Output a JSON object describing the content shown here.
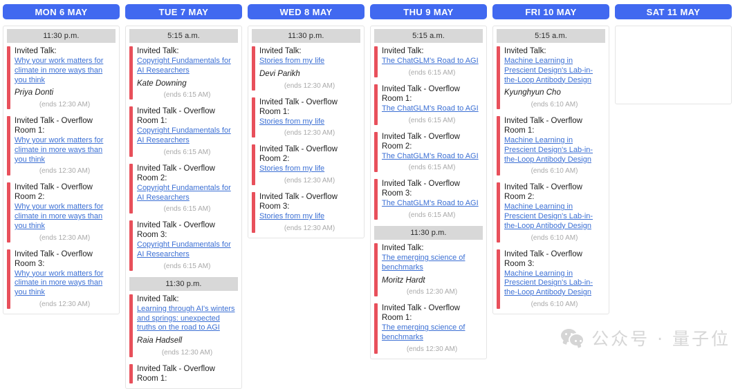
{
  "meta": {
    "accent_header_color": "#4169f0",
    "event_accent_color": "#e8505b",
    "link_color": "#3b6fd4",
    "time_bar_color": "#d8d8d8"
  },
  "watermark": {
    "icon": "wechat-icon",
    "text": "公众号 · 量子位"
  },
  "days": [
    {
      "header": "MON 6 MAY",
      "groups": [
        {
          "time": "11:30 p.m.",
          "events": [
            {
              "type": "Invited Talk:",
              "title": "Why your work matters for climate in more ways than you think",
              "speaker": "Priya Donti",
              "ends": "(ends 12:30 AM)"
            },
            {
              "type": "Invited Talk - Overflow Room 1:",
              "title": "Why your work matters for climate in more ways than you think",
              "speaker": "",
              "ends": "(ends 12:30 AM)"
            },
            {
              "type": "Invited Talk - Overflow Room 2:",
              "title": "Why your work matters for climate in more ways than you think",
              "speaker": "",
              "ends": "(ends 12:30 AM)"
            },
            {
              "type": "Invited Talk - Overflow Room 3:",
              "title": "Why your work matters for climate in more ways than you think",
              "speaker": "",
              "ends": "(ends 12:30 AM)"
            }
          ]
        }
      ]
    },
    {
      "header": "TUE 7 MAY",
      "groups": [
        {
          "time": "5:15 a.m.",
          "events": [
            {
              "type": "Invited Talk:",
              "title": "Copyright Fundamentals for AI Researchers",
              "speaker": "Kate Downing",
              "ends": "(ends 6:15 AM)"
            },
            {
              "type": "Invited Talk - Overflow Room 1:",
              "title": "Copyright Fundamentals for AI Researchers",
              "speaker": "",
              "ends": "(ends 6:15 AM)"
            },
            {
              "type": "Invited Talk - Overflow Room 2:",
              "title": "Copyright Fundamentals for AI Researchers",
              "speaker": "",
              "ends": "(ends 6:15 AM)"
            },
            {
              "type": "Invited Talk - Overflow Room 3:",
              "title": "Copyright Fundamentals for AI Researchers",
              "speaker": "",
              "ends": "(ends 6:15 AM)"
            }
          ]
        },
        {
          "time": "11:30 p.m.",
          "events": [
            {
              "type": "Invited Talk:",
              "title": "Learning through AI's winters and springs: unexpected truths on the road to AGI",
              "speaker": "Raia Hadsell",
              "ends": "(ends 12:30 AM)"
            },
            {
              "type": "Invited Talk - Overflow Room 1:",
              "title": "",
              "speaker": "",
              "ends": ""
            }
          ]
        }
      ]
    },
    {
      "header": "WED 8 MAY",
      "groups": [
        {
          "time": "11:30 p.m.",
          "events": [
            {
              "type": "Invited Talk:",
              "title": "Stories from my life",
              "speaker": "Devi Parikh",
              "ends": "(ends 12:30 AM)"
            },
            {
              "type": "Invited Talk - Overflow Room 1:",
              "title": "Stories from my life",
              "speaker": "",
              "ends": "(ends 12:30 AM)"
            },
            {
              "type": "Invited Talk - Overflow Room 2:",
              "title": "Stories from my life",
              "speaker": "",
              "ends": "(ends 12:30 AM)"
            },
            {
              "type": "Invited Talk - Overflow Room 3:",
              "title": "Stories from my life",
              "speaker": "",
              "ends": "(ends 12:30 AM)"
            }
          ]
        }
      ]
    },
    {
      "header": "THU 9 MAY",
      "groups": [
        {
          "time": "5:15 a.m.",
          "events": [
            {
              "type": "Invited Talk:",
              "title": "The ChatGLM's Road to AGI",
              "speaker": "",
              "ends": "(ends 6:15 AM)"
            },
            {
              "type": "Invited Talk - Overflow Room 1:",
              "title": "The ChatGLM's Road to AGI",
              "speaker": "",
              "ends": "(ends 6:15 AM)"
            },
            {
              "type": "Invited Talk - Overflow Room 2:",
              "title": "The ChatGLM's Road to AGI",
              "speaker": "",
              "ends": "(ends 6:15 AM)"
            },
            {
              "type": "Invited Talk - Overflow Room 3:",
              "title": "The ChatGLM's Road to AGI",
              "speaker": "",
              "ends": "(ends 6:15 AM)"
            }
          ]
        },
        {
          "time": "11:30 p.m.",
          "events": [
            {
              "type": "Invited Talk:",
              "title": "The emerging science of benchmarks",
              "speaker": "Moritz Hardt",
              "ends": "(ends 12:30 AM)"
            },
            {
              "type": "Invited Talk - Overflow Room 1:",
              "title": "The emerging science of benchmarks",
              "speaker": "",
              "ends": "(ends 12:30 AM)"
            }
          ]
        }
      ]
    },
    {
      "header": "FRI 10 MAY",
      "groups": [
        {
          "time": "5:15 a.m.",
          "events": [
            {
              "type": "Invited Talk:",
              "title": "Machine Learning in Prescient Design's Lab-in-the-Loop Antibody Design",
              "speaker": "Kyunghyun Cho",
              "ends": "(ends 6:10 AM)"
            },
            {
              "type": "Invited Talk - Overflow Room 1:",
              "title": "Machine Learning in Prescient Design's Lab-in-the-Loop Antibody Design",
              "speaker": "",
              "ends": "(ends 6:10 AM)"
            },
            {
              "type": "Invited Talk - Overflow Room 2:",
              "title": "Machine Learning in Prescient Design's Lab-in-the-Loop Antibody Design",
              "speaker": "",
              "ends": "(ends 6:10 AM)"
            },
            {
              "type": "Invited Talk - Overflow Room 3:",
              "title": "Machine Learning in Prescient Design's Lab-in-the-Loop Antibody Design",
              "speaker": "",
              "ends": "(ends 6:10 AM)"
            }
          ]
        }
      ]
    },
    {
      "header": "SAT 11 MAY",
      "groups": []
    }
  ]
}
